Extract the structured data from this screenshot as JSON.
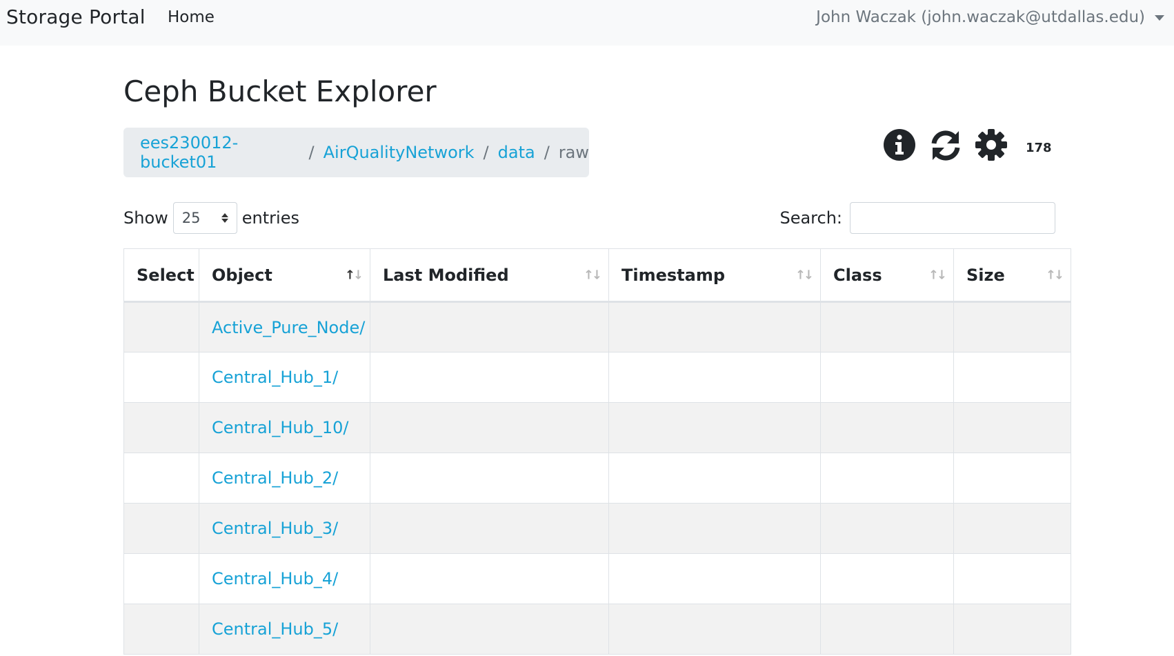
{
  "navbar": {
    "brand": "Storage Portal",
    "home": "Home",
    "user": "John Waczak (john.waczak@utdallas.edu)"
  },
  "page": {
    "title": "Ceph Bucket Explorer"
  },
  "breadcrumb": {
    "items": [
      "ees230012-bucket01",
      "AirQualityNetwork",
      "data"
    ],
    "active": "raw",
    "separator": "/"
  },
  "toolbar": {
    "icons": [
      "info-icon",
      "refresh-icon",
      "gear-icon"
    ],
    "count": "178"
  },
  "length": {
    "prefix": "Show",
    "value": "25",
    "suffix": "entries"
  },
  "search": {
    "label": "Search:",
    "value": ""
  },
  "table": {
    "columns": [
      "Select",
      "Object",
      "Last Modified",
      "Timestamp",
      "Class",
      "Size"
    ],
    "rows": [
      {
        "object": "Active_Pure_Node/"
      },
      {
        "object": "Central_Hub_1/"
      },
      {
        "object": "Central_Hub_10/"
      },
      {
        "object": "Central_Hub_2/"
      },
      {
        "object": "Central_Hub_3/"
      },
      {
        "object": "Central_Hub_4/"
      },
      {
        "object": "Central_Hub_5/"
      }
    ]
  },
  "colors": {
    "link": "#17a2d6",
    "navbar_bg": "#f8f9fa",
    "breadcrumb_bg": "#e9ecef",
    "stripe": "#f2f2f2"
  }
}
